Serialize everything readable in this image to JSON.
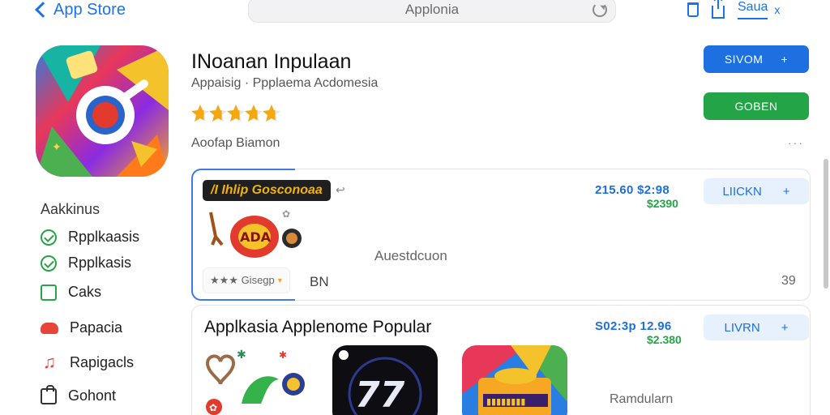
{
  "nav": {
    "back_label": "App Store",
    "url_text": "Apploniа",
    "save_label": "Saua",
    "close_glyph": "x"
  },
  "app": {
    "title": "INoanan Inpulaan",
    "subtitle": "Appaisig · Ppplaema Acdomesia",
    "rating_fraction": 0.7,
    "meta": "Aoofap Biamon",
    "primary_button": "SIVOM",
    "primary_button_icon": "+",
    "secondary_button": "GOBEN",
    "more_glyph": "···"
  },
  "sidebar": {
    "title": "Aakkinus",
    "items": [
      {
        "label": "Rpplkaasis",
        "icon": "check-circle-icon"
      },
      {
        "label": "Rpplkasis",
        "icon": "check-circle-icon"
      },
      {
        "label": "Caks",
        "icon": "checkbox-icon"
      },
      {
        "label": "Papacia",
        "icon": "cloud-icon"
      },
      {
        "label": "Rapigacls",
        "icon": "music-note-icon"
      },
      {
        "label": "Gohont",
        "icon": "bag-icon"
      }
    ]
  },
  "featured": {
    "promo_label": "/I Ihlip Gosconoaa",
    "promo_link": "↩",
    "price_a": "215.60  $2:98",
    "price_b": "$2390",
    "button": "LIICKN",
    "button_icon": "+",
    "rating_chip": "★★★ Gisegp",
    "size": "BN",
    "description": "Auestdcuon",
    "count": "39"
  },
  "popular": {
    "title": "Applkasia Applenome Popular",
    "price_a": "S02:3p  12.96",
    "price_b": "$2.380",
    "button": "LIVRN",
    "button_icon": "+",
    "label": "Ramdularn"
  },
  "colors": {
    "accent_blue": "#1e6fe0",
    "accent_green": "#23a447",
    "star": "#f3a712"
  }
}
